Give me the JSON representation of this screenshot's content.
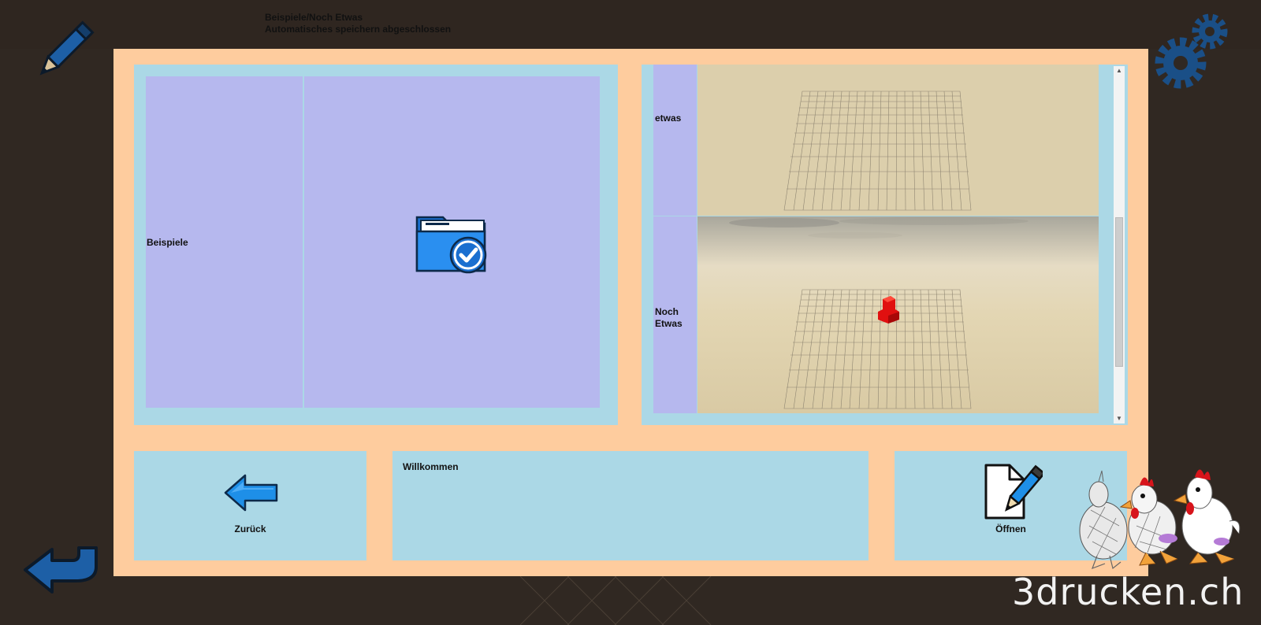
{
  "header": {
    "path": "Beispiele/Noch Etwas",
    "status": "Automatisches speichern abgeschlossen"
  },
  "tools": {
    "pencil_icon": "pencil-icon",
    "settings_icon": "gear-icon",
    "undo_icon": "curved-back-arrow-icon"
  },
  "left_panel": {
    "tile": {
      "label": "Beispiele",
      "icon": "folder-check-icon"
    }
  },
  "right_panel": {
    "entries": [
      {
        "name": "etwas",
        "preview": "empty-grid-scene"
      },
      {
        "name": "Noch Etwas",
        "preview": "grid-scene-red-object"
      }
    ],
    "scroll_position": 0.75
  },
  "buttons": {
    "back": {
      "label": "Zurück",
      "icon": "left-arrow-icon"
    },
    "open": {
      "label": "Öffnen",
      "icon": "edit-document-icon"
    }
  },
  "message": {
    "text": "Willkommen"
  },
  "watermark": {
    "text": "3drucken.ch"
  },
  "colors": {
    "background": "#302822",
    "dialog": "#fecc9e",
    "panel": "#abd8e6",
    "tile": "#b6b8ee",
    "accent_blue": "#1e8fe8",
    "scene_sand": "#dccfac",
    "object_red": "#e01010"
  }
}
